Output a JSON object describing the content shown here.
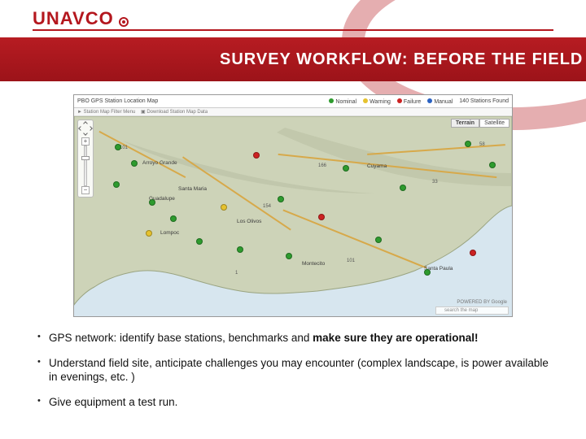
{
  "brand": {
    "name": "UNAVCO"
  },
  "slide": {
    "title": "SURVEY WORKFLOW: BEFORE THE FIELD"
  },
  "map": {
    "title": "PBO GPS Station Location Map",
    "filter_line": "► Station Map Filter Menu",
    "download_line": "▣ Download Station Map Data",
    "legend": {
      "nominal": "Nominal",
      "warning": "Warning",
      "failure": "Failure",
      "manual": "Manual",
      "count": "140 Stations Found"
    },
    "type_buttons": {
      "terrain": "Terrain",
      "satellite": "Satellite"
    },
    "search_placeholder": "search the map",
    "powered": "POWERED BY Google",
    "roads": {
      "r101a": "101",
      "r101b": "101",
      "r1": "1",
      "r154": "154",
      "r166": "166",
      "r33": "33",
      "r58": "58"
    },
    "places": {
      "santa_maria": "Santa Maria",
      "lompoc": "Lompoc",
      "montecito": "Montecito",
      "santa_paula": "Santa Paula",
      "los_olivos": "Los Olivos",
      "arroyo_grande": "Arroyo Grande",
      "guadalupe": "Guadalupe",
      "cuyama": "Cuyama"
    }
  },
  "bullets": {
    "b1_prefix": "GPS network: identify base stations, benchmarks and ",
    "b1_bold": "make sure they are operational!",
    "b2": "Understand field site, anticipate challenges you may encounter (complex landscape, is power available in evenings, etc. )",
    "b3": "Give equipment a test run."
  }
}
